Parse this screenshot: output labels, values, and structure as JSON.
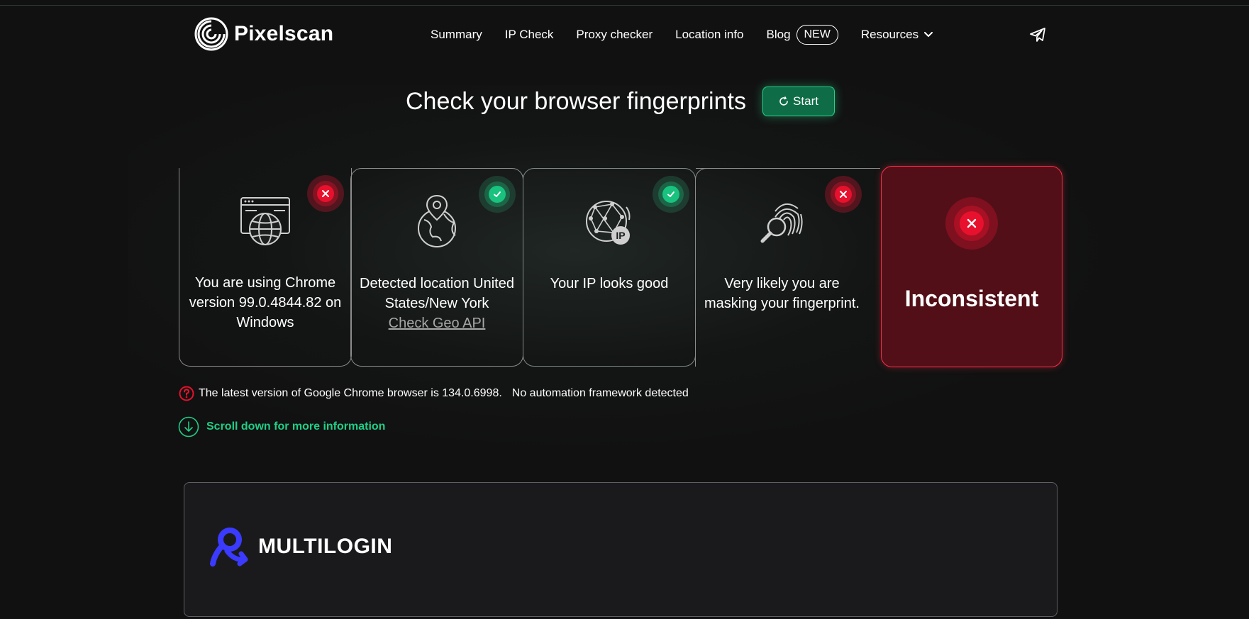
{
  "header": {
    "logo_text": "Pixelscan",
    "nav": [
      {
        "label": "Summary"
      },
      {
        "label": "IP Check"
      },
      {
        "label": "Proxy checker"
      },
      {
        "label": "Location info"
      },
      {
        "label": "Blog",
        "badge": "NEW"
      },
      {
        "label": "Resources"
      }
    ]
  },
  "hero": {
    "title": "Check your browser fingerprints",
    "start_label": "Start"
  },
  "cards": [
    {
      "status": "bad",
      "icon": "browser-globe-icon",
      "text": "You are using Chrome version 99.0.4844.82 on Windows"
    },
    {
      "status": "good",
      "icon": "location-globe-icon",
      "text": "Detected location United States/New York",
      "link": "Check Geo API"
    },
    {
      "status": "good",
      "icon": "ip-globe-icon",
      "text": "Your IP looks good"
    },
    {
      "status": "bad",
      "icon": "fingerprint-magnifier-icon",
      "text": "Very likely you are masking your fingerprint."
    }
  ],
  "result": {
    "status": "bad",
    "label": "Inconsistent"
  },
  "info": {
    "chrome_version": "The latest version of Google Chrome browser is 134.0.6998.",
    "automation": "No automation framework detected"
  },
  "scroll_label": "Scroll down for more information",
  "banner": {
    "brand": "MULTILOGIN"
  },
  "colors": {
    "background": "#111111",
    "accent_green": "#1fcf86",
    "error_red": "#e8112d",
    "result_bg": "#520f17"
  }
}
